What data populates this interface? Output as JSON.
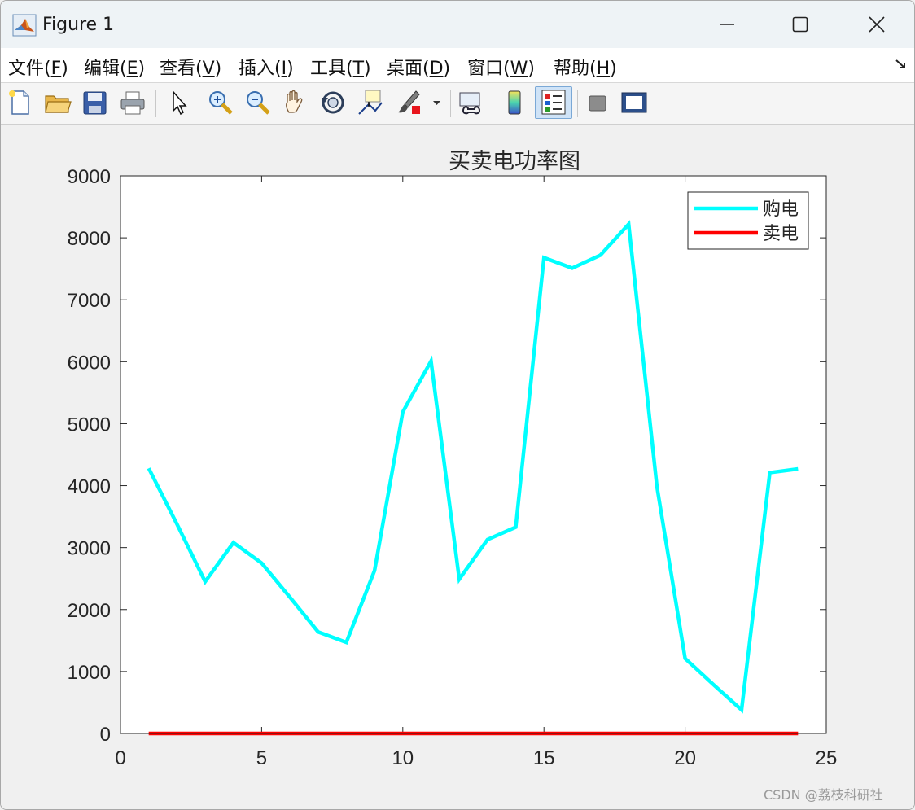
{
  "window": {
    "title": "Figure 1"
  },
  "menu": {
    "items": [
      {
        "label": "文件(",
        "key": "F",
        "tail": ")"
      },
      {
        "label": "编辑(",
        "key": "E",
        "tail": ")"
      },
      {
        "label": "查看(",
        "key": "V",
        "tail": ")"
      },
      {
        "label": "插入(",
        "key": "I",
        "tail": ")"
      },
      {
        "label": "工具(",
        "key": "T",
        "tail": ")"
      },
      {
        "label": "桌面(",
        "key": "D",
        "tail": ")"
      },
      {
        "label": "窗口(",
        "key": "W",
        "tail": ")"
      },
      {
        "label": "帮助(",
        "key": "H",
        "tail": ")"
      }
    ]
  },
  "toolbar": {
    "icons": [
      "new-figure-icon",
      "open-file-icon",
      "save-icon",
      "print-icon",
      "pointer-icon",
      "zoom-in-icon",
      "zoom-out-icon",
      "pan-hand-icon",
      "rotate-3d-icon",
      "data-cursor-icon",
      "brush-icon",
      "brush-dropdown-icon",
      "link-plot-icon",
      "colorbar-icon",
      "legend-icon",
      "hide-plot-tools-icon",
      "show-plot-tools-icon"
    ]
  },
  "chart_data": {
    "type": "line",
    "title": "买卖电功率图",
    "xlabel": "",
    "ylabel": "",
    "xlim": [
      0,
      25
    ],
    "ylim": [
      0,
      9000
    ],
    "xticks": [
      0,
      5,
      10,
      15,
      20,
      25
    ],
    "yticks": [
      0,
      1000,
      2000,
      3000,
      4000,
      5000,
      6000,
      7000,
      8000,
      9000
    ],
    "grid": false,
    "legend_position": "top-right",
    "x": [
      1,
      2,
      3,
      4,
      5,
      6,
      7,
      8,
      9,
      10,
      11,
      12,
      13,
      14,
      15,
      16,
      17,
      18,
      19,
      20,
      21,
      22,
      23,
      24
    ],
    "series": [
      {
        "name": "购电",
        "color": "#00ffff",
        "values": [
          4280,
          3380,
          2450,
          3080,
          2750,
          2200,
          1640,
          1470,
          2630,
          5190,
          6010,
          2490,
          3130,
          3330,
          7680,
          7510,
          7720,
          8220,
          3990,
          1210,
          790,
          380,
          4210,
          4270
        ]
      },
      {
        "name": "卖电",
        "color": "#ff0000",
        "values": [
          0,
          0,
          0,
          0,
          0,
          0,
          0,
          0,
          0,
          0,
          0,
          0,
          0,
          0,
          0,
          0,
          0,
          0,
          0,
          0,
          0,
          0,
          0,
          0
        ]
      }
    ]
  },
  "watermark": "CSDN @荔枝科研社"
}
